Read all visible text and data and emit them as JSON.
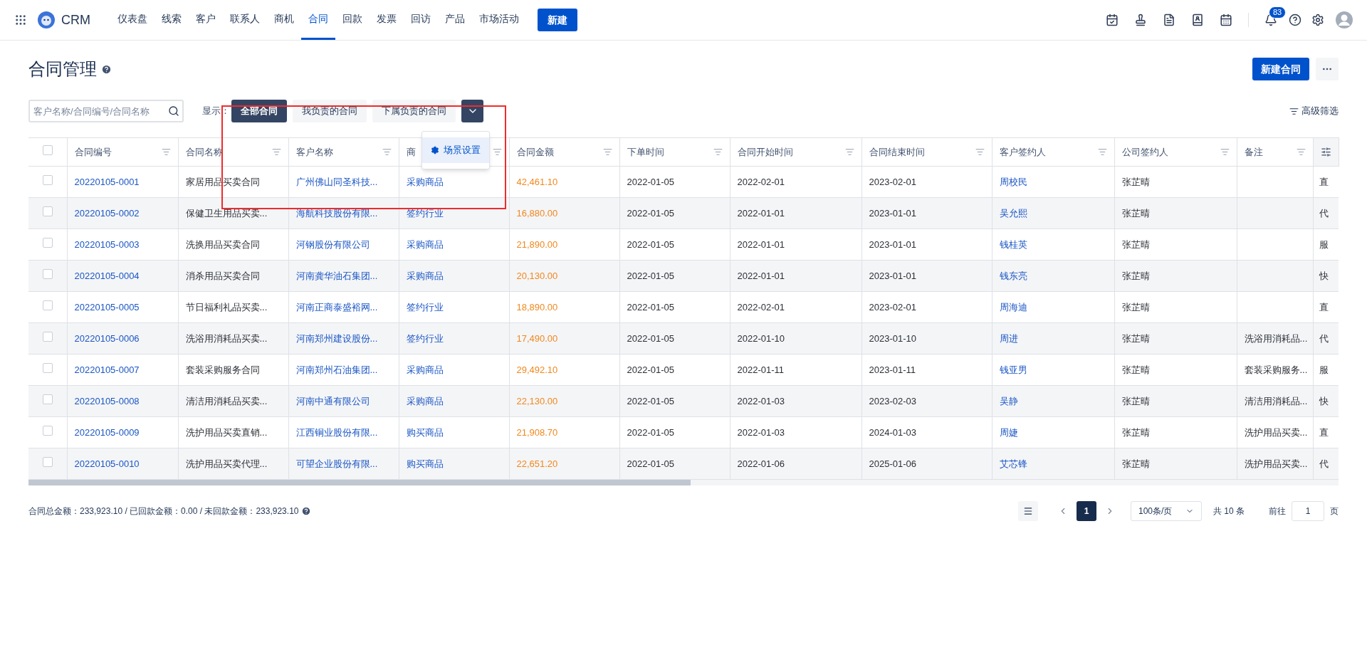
{
  "nav": {
    "logo_text": "CRM",
    "items": [
      {
        "label": "仪表盘",
        "selected": false
      },
      {
        "label": "线索",
        "selected": false
      },
      {
        "label": "客户",
        "selected": false
      },
      {
        "label": "联系人",
        "selected": false
      },
      {
        "label": "商机",
        "selected": false
      },
      {
        "label": "合同",
        "selected": true
      },
      {
        "label": "回款",
        "selected": false
      },
      {
        "label": "发票",
        "selected": false
      },
      {
        "label": "回访",
        "selected": false
      },
      {
        "label": "产品",
        "selected": false
      },
      {
        "label": "市场活动",
        "selected": false
      }
    ],
    "new_button": "新建",
    "notification_count": "83"
  },
  "page": {
    "title": "合同管理",
    "primary_button": "新建合同"
  },
  "toolbar": {
    "search": {
      "placeholder": "客户名称/合同编号/合同名称"
    },
    "show_label": "显示：",
    "scenes": [
      {
        "label": "全部合同",
        "selected": true
      },
      {
        "label": "我负责的合同",
        "selected": false
      },
      {
        "label": "下属负责的合同",
        "selected": false
      }
    ],
    "scene_menu": {
      "expanded": true,
      "items": [
        "场景设置"
      ]
    },
    "advanced_filter": "高级筛选"
  },
  "table": {
    "all_checked": false,
    "columns": [
      {
        "label": "合同编号",
        "kind": "link"
      },
      {
        "label": "合同名称",
        "kind": "text"
      },
      {
        "label": "客户名称",
        "kind": "link"
      },
      {
        "label": "商",
        "kind": "link"
      },
      {
        "label": "合同金额",
        "kind": "amount"
      },
      {
        "label": "下单时间",
        "kind": "text"
      },
      {
        "label": "合同开始时间",
        "kind": "text"
      },
      {
        "label": "合同结束时间",
        "kind": "text"
      },
      {
        "label": "客户签约人",
        "kind": "link"
      },
      {
        "label": "公司签约人",
        "kind": "text"
      },
      {
        "label": "备注",
        "kind": "text"
      },
      {
        "kind": "text"
      }
    ],
    "rows": [
      {
        "checked": false,
        "cells": [
          "20220105-0001",
          "家居用品买卖合同",
          "广州佛山同圣科技...",
          "采购商品",
          "42,461.10",
          "2022-01-05",
          "2022-02-01",
          "2023-02-01",
          "周校民",
          "张芷晴",
          "",
          "直"
        ]
      },
      {
        "checked": false,
        "cells": [
          "20220105-0002",
          "保健卫生用品买卖...",
          "海航科技股份有限...",
          "签约行业",
          "16,880.00",
          "2022-01-05",
          "2022-01-01",
          "2023-01-01",
          "吴允熙",
          "张芷晴",
          "",
          "代"
        ]
      },
      {
        "checked": false,
        "cells": [
          "20220105-0003",
          "洗换用品买卖合同",
          "河钢股份有限公司",
          "采购商品",
          "21,890.00",
          "2022-01-05",
          "2022-01-01",
          "2023-01-01",
          "钱桂英",
          "张芷晴",
          "",
          "服"
        ]
      },
      {
        "checked": false,
        "cells": [
          "20220105-0004",
          "消杀用品买卖合同",
          "河南龚华油石集团...",
          "采购商品",
          "20,130.00",
          "2022-01-05",
          "2022-01-01",
          "2023-01-01",
          "钱东亮",
          "张芷晴",
          "",
          "快"
        ]
      },
      {
        "checked": false,
        "cells": [
          "20220105-0005",
          "节日福利礼品买卖...",
          "河南正商泰盛裕网...",
          "签约行业",
          "18,890.00",
          "2022-01-05",
          "2022-02-01",
          "2023-02-01",
          "周海迪",
          "张芷晴",
          "",
          "直"
        ]
      },
      {
        "checked": false,
        "cells": [
          "20220105-0006",
          "洗浴用消耗品买卖...",
          "河南郑州建设股份...",
          "签约行业",
          "17,490.00",
          "2022-01-05",
          "2022-01-10",
          "2023-01-10",
          "周进",
          "张芷晴",
          "洗浴用消耗品...",
          "代"
        ]
      },
      {
        "checked": false,
        "cells": [
          "20220105-0007",
          "套装采购服务合同",
          "河南郑州石油集团...",
          "采购商品",
          "29,492.10",
          "2022-01-05",
          "2022-01-11",
          "2023-01-11",
          "钱亚男",
          "张芷晴",
          "套装采购服务...",
          "服"
        ]
      },
      {
        "checked": false,
        "cells": [
          "20220105-0008",
          "清洁用消耗品买卖...",
          "河南中通有限公司",
          "采购商品",
          "22,130.00",
          "2022-01-05",
          "2022-01-03",
          "2023-02-03",
          "吴静",
          "张芷晴",
          "清洁用消耗品...",
          "快"
        ]
      },
      {
        "checked": false,
        "cells": [
          "20220105-0009",
          "洗护用品买卖直销...",
          "江西铜业股份有限...",
          "购买商品",
          "21,908.70",
          "2022-01-05",
          "2022-01-03",
          "2024-01-03",
          "周婕",
          "张芷晴",
          "洗护用品买卖...",
          "直"
        ]
      },
      {
        "checked": false,
        "cells": [
          "20220105-0010",
          "洗护用品买卖代理...",
          "可望企业股份有限...",
          "购买商品",
          "22,651.20",
          "2022-01-05",
          "2022-01-06",
          "2025-01-06",
          "艾芯锋",
          "张芷晴",
          "洗护用品买卖...",
          "代"
        ]
      }
    ]
  },
  "footer": {
    "summary": "合同总金额：233,923.10 / 已回款金额：0.00 / 未回款金额：233,923.10",
    "pages": [
      {
        "label": "1",
        "selected": true
      }
    ],
    "page_size": "100条/页",
    "total": "共 10 条",
    "goto_label": "前往",
    "goto_value": "1",
    "goto_suffix": "页"
  }
}
